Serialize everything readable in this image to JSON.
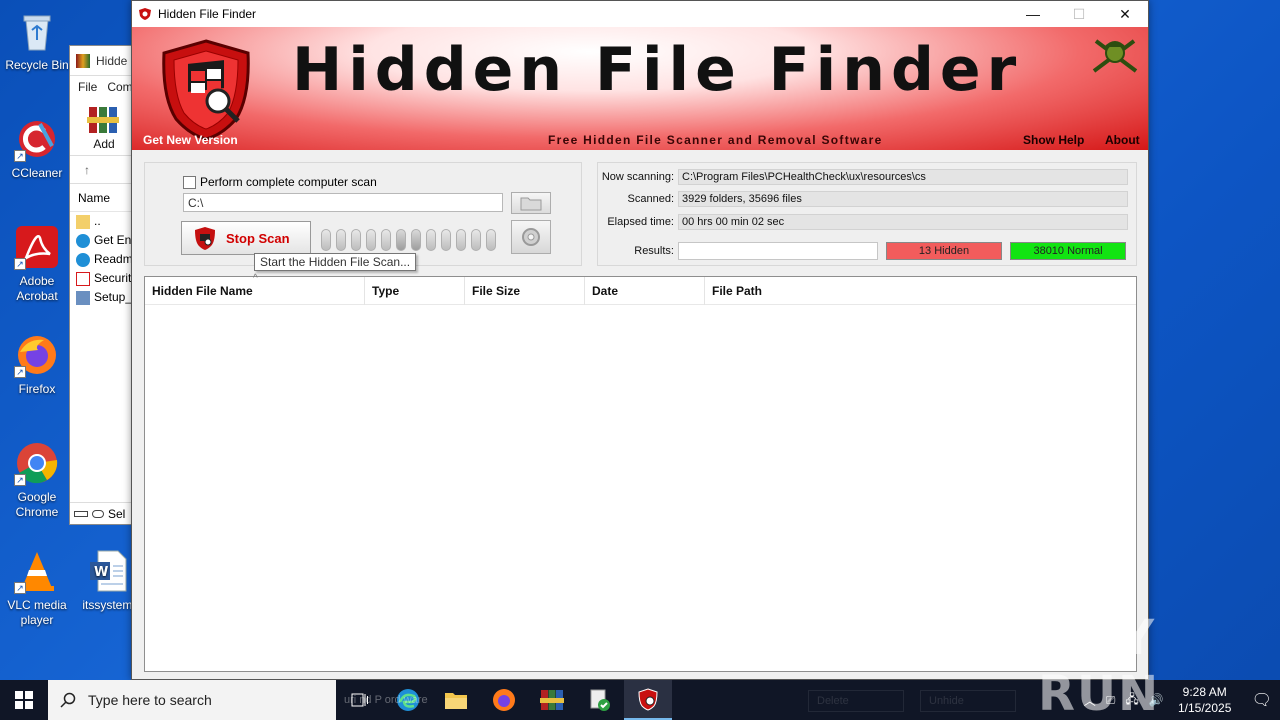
{
  "desktop": {
    "icons": [
      {
        "label": "Recycle Bin"
      },
      {
        "label": "CCleaner"
      },
      {
        "label": "Adobe Acrobat"
      },
      {
        "label": "Firefox"
      },
      {
        "label": "Google Chrome"
      },
      {
        "label": "VLC media player"
      },
      {
        "label": "itssystem."
      }
    ]
  },
  "explorer": {
    "title": "Hidde",
    "menu": [
      "File",
      "Com"
    ],
    "ribbon_add": "Add",
    "column_name": "Name",
    "rows": [
      "..",
      "Get Ent",
      "Readm",
      "Security",
      "Setup_"
    ],
    "status": "Sel"
  },
  "window": {
    "title": "Hidden File Finder",
    "minimize": "—",
    "maximize": "☐",
    "close": "✕"
  },
  "banner": {
    "title": "Hidden File Finder",
    "subtitle": "Free Hidden File Scanner and Removal Software",
    "get_new_version": "Get New Version",
    "show_help": "Show Help",
    "about": "About"
  },
  "scan": {
    "complete_scan_label": "Perform complete computer scan",
    "complete_scan_checked": false,
    "path_value": "C:\\",
    "stop_button": "Stop Scan",
    "tooltip": "Start the Hidden File Scan..."
  },
  "status": {
    "now_scanning_label": "Now scanning:",
    "now_scanning_value": "C:\\Program Files\\PCHealthCheck\\ux\\resources\\cs",
    "scanned_label": "Scanned:",
    "scanned_value": "3929 folders, 35696 files",
    "elapsed_label": "Elapsed time:",
    "elapsed_value": "00 hrs 00 min 02 sec",
    "results_label": "Results:",
    "hidden_count": "13 Hidden",
    "normal_count": "38010 Normal"
  },
  "table": {
    "columns": [
      "Hidden File Name",
      "Type",
      "File Size",
      "Date",
      "File Path"
    ],
    "rows": []
  },
  "bottom_bar": {
    "delete": "Delete",
    "unhide": "Unhide",
    "partial_text": "uri  nd P   ord  ware"
  },
  "watermark": "ANY RUN",
  "taskbar": {
    "search_placeholder": "Type here to search",
    "time": "9:28 AM",
    "date": "1/15/2025"
  }
}
